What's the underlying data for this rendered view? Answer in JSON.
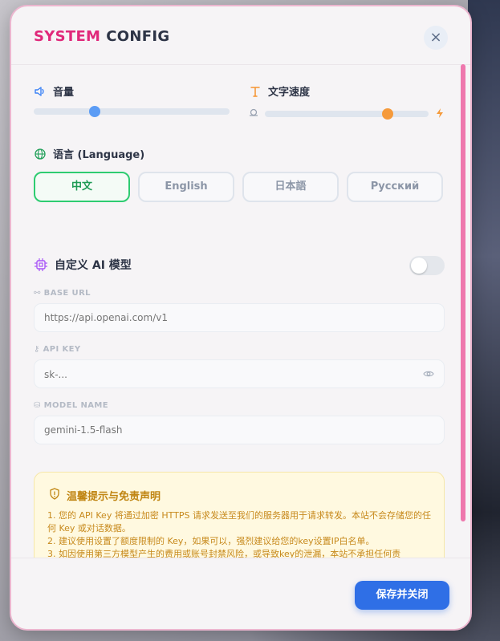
{
  "header": {
    "title_part1": "SYSTEM",
    "title_part2": "CONFIG",
    "close_icon": "×"
  },
  "volume": {
    "label": "音量",
    "icon": "speaker-icon",
    "level": 0.31
  },
  "text_speed": {
    "label": "文字速度",
    "icon": "text-t-icon",
    "level": 0.75,
    "slow_icon": "snail-icon",
    "fast_icon": "lightning-icon"
  },
  "language": {
    "label": "语言 (Language)",
    "icon": "globe-icon",
    "options": [
      "中文",
      "English",
      "日本語",
      "Русский"
    ],
    "selected": "中文"
  },
  "custom_ai": {
    "title": "自定义 AI 模型",
    "icon": "chip-icon",
    "enabled": false,
    "base_url": {
      "label": "BASE URL",
      "placeholder": "https://api.openai.com/v1"
    },
    "api_key": {
      "label": "API KEY",
      "placeholder": "sk-..."
    },
    "model_name": {
      "label": "MODEL NAME",
      "placeholder": "gemini-1.5-flash"
    }
  },
  "notice": {
    "title": "温馨提示与免责声明",
    "icon": "shield-icon",
    "lines": [
      "1. 您的 API Key 将通过加密 HTTPS 请求发送至我们的服务器用于请求转发。本站不会存储您的任何 Key 或对话数据。",
      "2. 建议使用设置了额度限制的 Key，如果可以，强烈建议给您的key设置IP白名单。",
      "3. 如因使用第三方模型产生的费用或账号封禁风险，或导致key的泄漏，本站不承担任何责"
    ]
  },
  "footer": {
    "save_label": "保存并关闭"
  },
  "colors": {
    "accent_pink": "#e0287a",
    "primary_blue": "#2f6fe6",
    "volume_knob": "#5b9cf5",
    "speed_knob": "#f59a3b",
    "selected_green": "#2ecc71"
  }
}
